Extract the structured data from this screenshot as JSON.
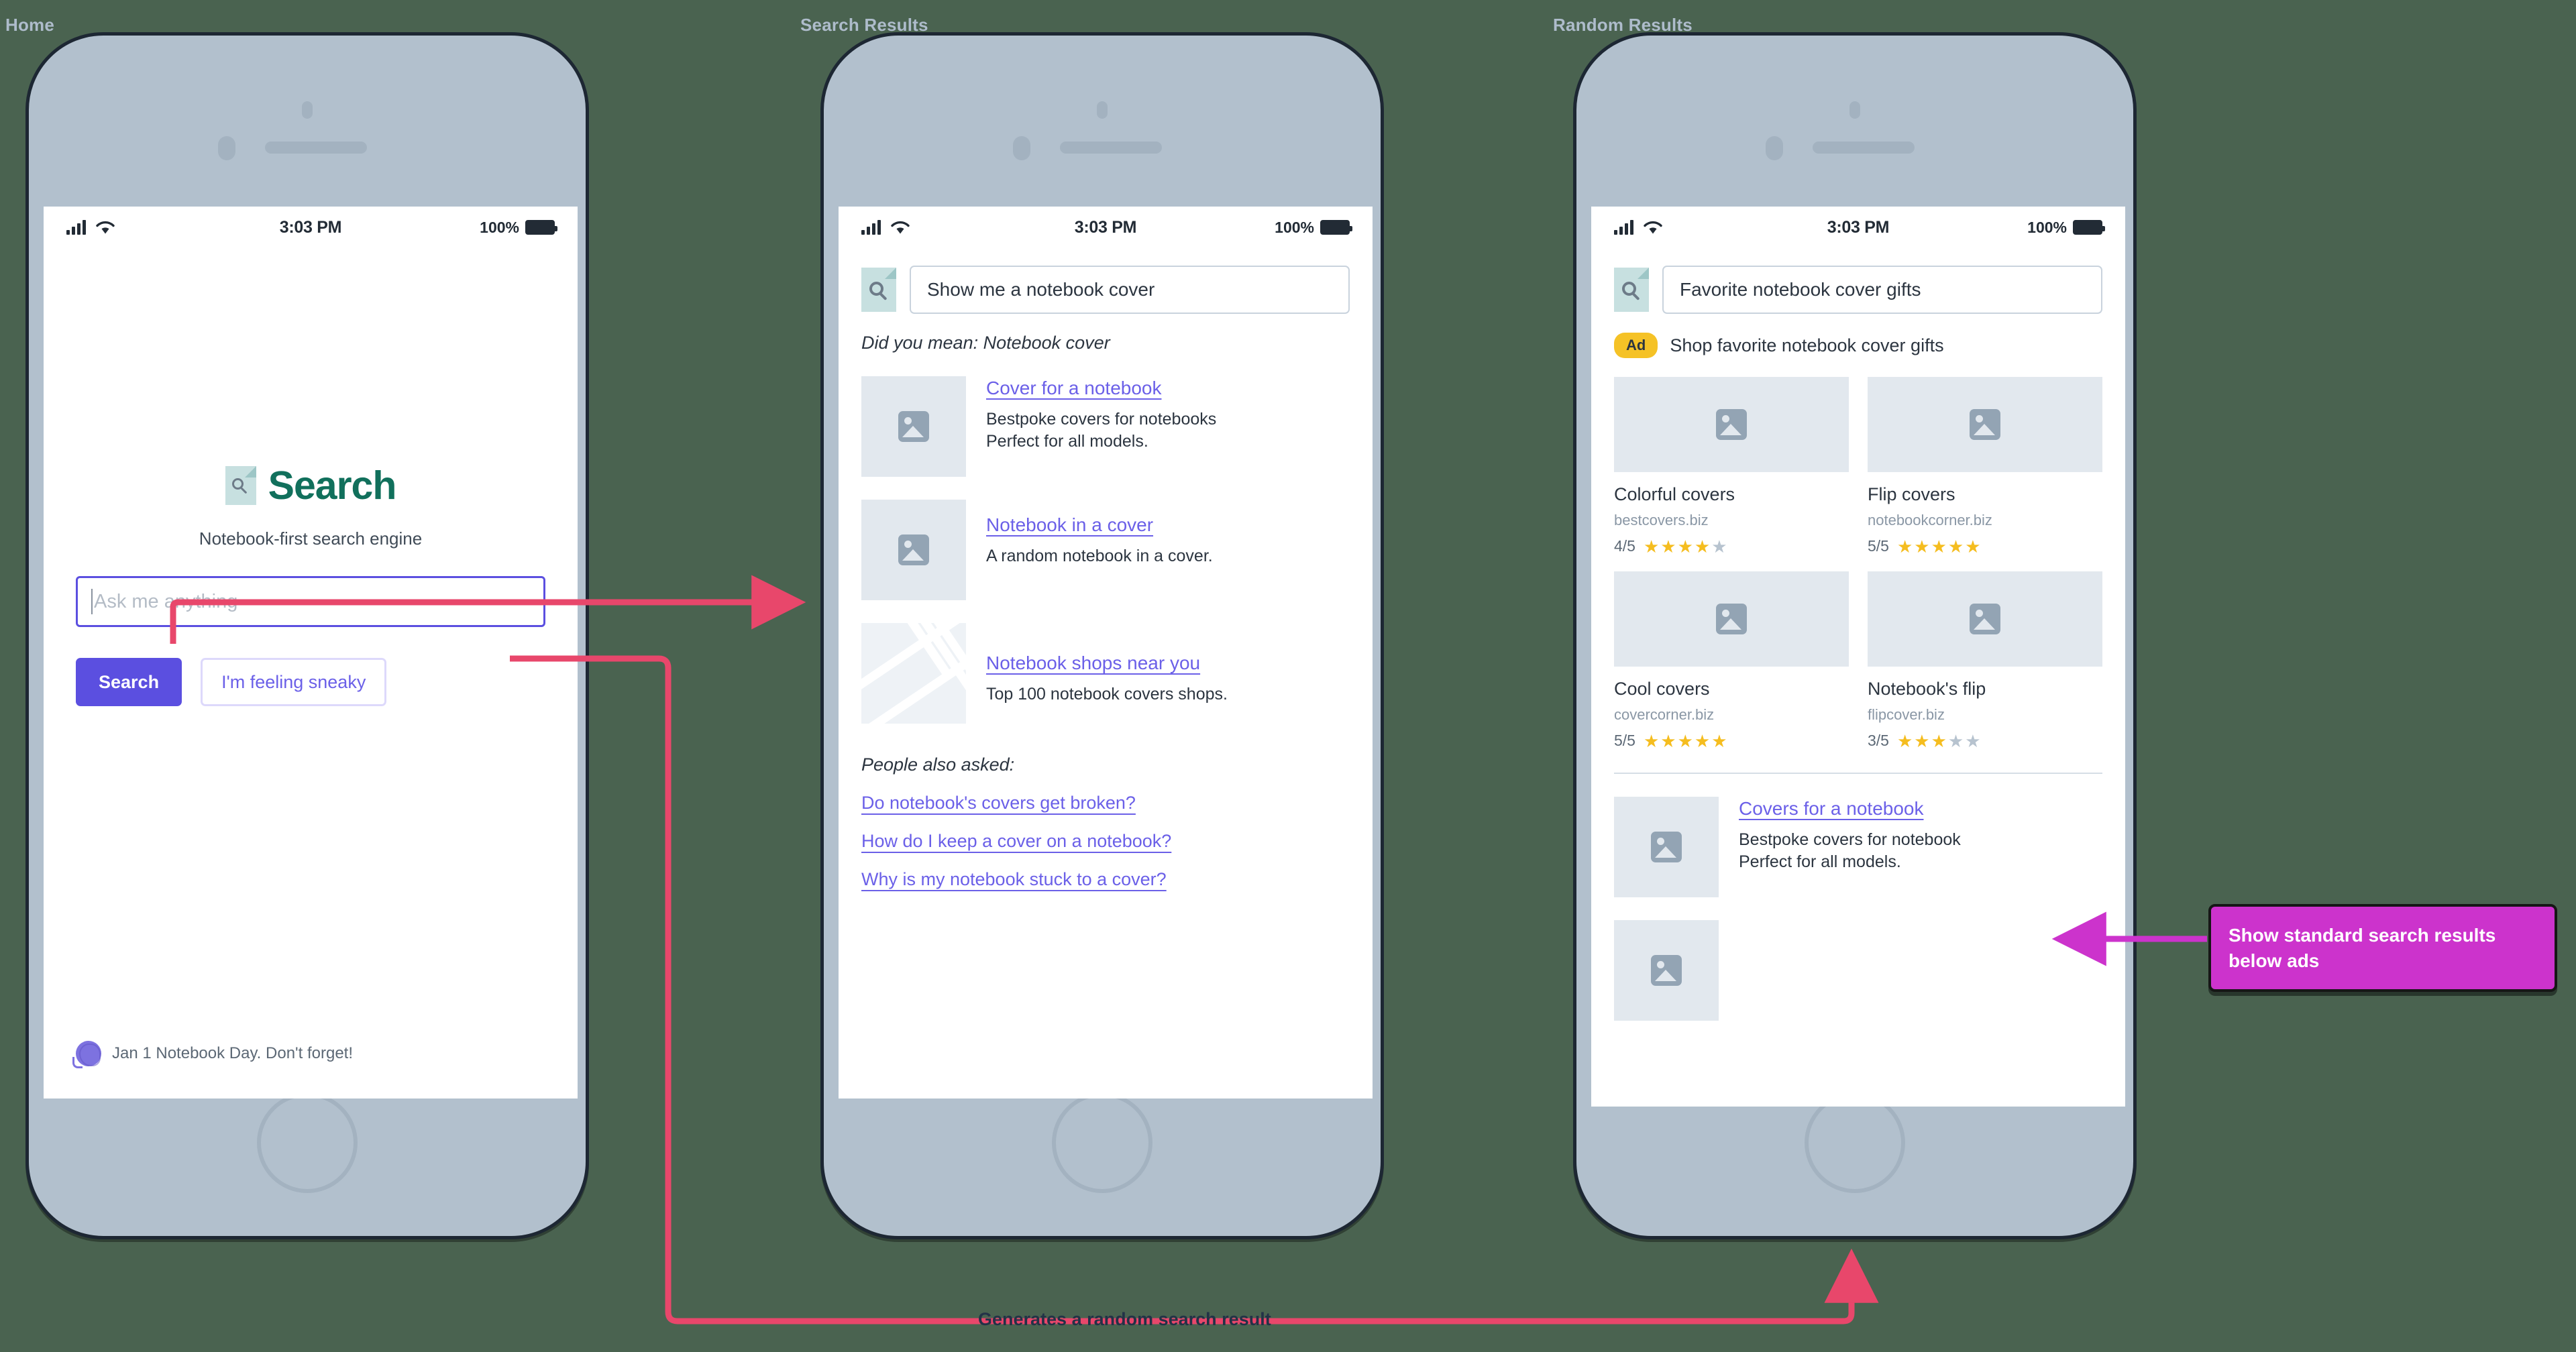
{
  "screens": [
    {
      "title": "Home"
    },
    {
      "title": "Search Results"
    },
    {
      "title": "Random Results"
    }
  ],
  "status_bar": {
    "time": "3:03 PM",
    "battery_percent": "100%",
    "signal_icon": "signal-bars-icon",
    "wifi_icon": "wifi-icon",
    "battery_icon": "battery-icon"
  },
  "home": {
    "logo_icon": "document-search-icon",
    "brand": "Search",
    "tagline": "Notebook-first search engine",
    "search_placeholder": "Ask me anything",
    "search_value": "",
    "primary_button": "Search",
    "secondary_button": "I'm feeling sneaky",
    "promo_icon": "yarn-ball-icon",
    "promo_text": "Jan 1 Notebook Day. Don't forget!"
  },
  "results": {
    "logo_icon": "document-search-icon",
    "query": "Show me a notebook cover",
    "did_you_mean": "Did you mean: Notebook cover",
    "items": [
      {
        "thumb": "image-placeholder-icon",
        "title": "Cover for a notebook",
        "description": "Bestpoke covers for notebooks\nPerfect for all models."
      },
      {
        "thumb": "image-placeholder-icon",
        "title": "Notebook in a cover",
        "description": "A random notebook in a cover."
      },
      {
        "thumb": "map-placeholder-icon",
        "title": "Notebook shops near you",
        "description": "Top 100 notebook covers shops."
      }
    ],
    "people_also_asked_title": "People also asked:",
    "people_also_asked": [
      "Do notebook's covers get broken?",
      "How do I keep a cover on a notebook?",
      "Why is my notebook stuck to a cover?"
    ]
  },
  "random": {
    "logo_icon": "document-search-icon",
    "query": "Favorite notebook cover gifts",
    "ad_badge": "Ad",
    "ad_label": "Shop favorite notebook cover gifts",
    "products": [
      {
        "thumb": "image-placeholder-icon",
        "name": "Colorful covers",
        "site": "bestcovers.biz",
        "rating_text": "4/5",
        "stars_on": 4,
        "stars_total": 5
      },
      {
        "thumb": "image-placeholder-icon",
        "name": "Flip covers",
        "site": "notebookcorner.biz",
        "rating_text": "5/5",
        "stars_on": 5,
        "stars_total": 5
      },
      {
        "thumb": "image-placeholder-icon",
        "name": "Cool covers",
        "site": "covercorner.biz",
        "rating_text": "5/5",
        "stars_on": 5,
        "stars_total": 5
      },
      {
        "thumb": "image-placeholder-icon",
        "name": "Notebook's flip",
        "site": "flipcover.biz",
        "rating_text": "3/5",
        "stars_on": 3,
        "stars_total": 5
      }
    ],
    "organic": {
      "thumb": "image-placeholder-icon",
      "title": "Covers for a notebook",
      "description": "Bestpoke covers for notebook\nPerfect for all models."
    }
  },
  "annotations": {
    "note": "Show standard search results below ads",
    "flow_label": "Generates a random search result"
  },
  "colors": {
    "brand_green": "#11705c",
    "accent_purple": "#5b4fe0",
    "link_purple": "#6b60e8",
    "ad_yellow": "#f5c226",
    "star_gold": "#f5bd1f",
    "connector_pink": "#e8476b",
    "note_magenta": "#cc33cc",
    "phone_bezel": "#b2c0cd",
    "background_green": "#4a6350"
  }
}
